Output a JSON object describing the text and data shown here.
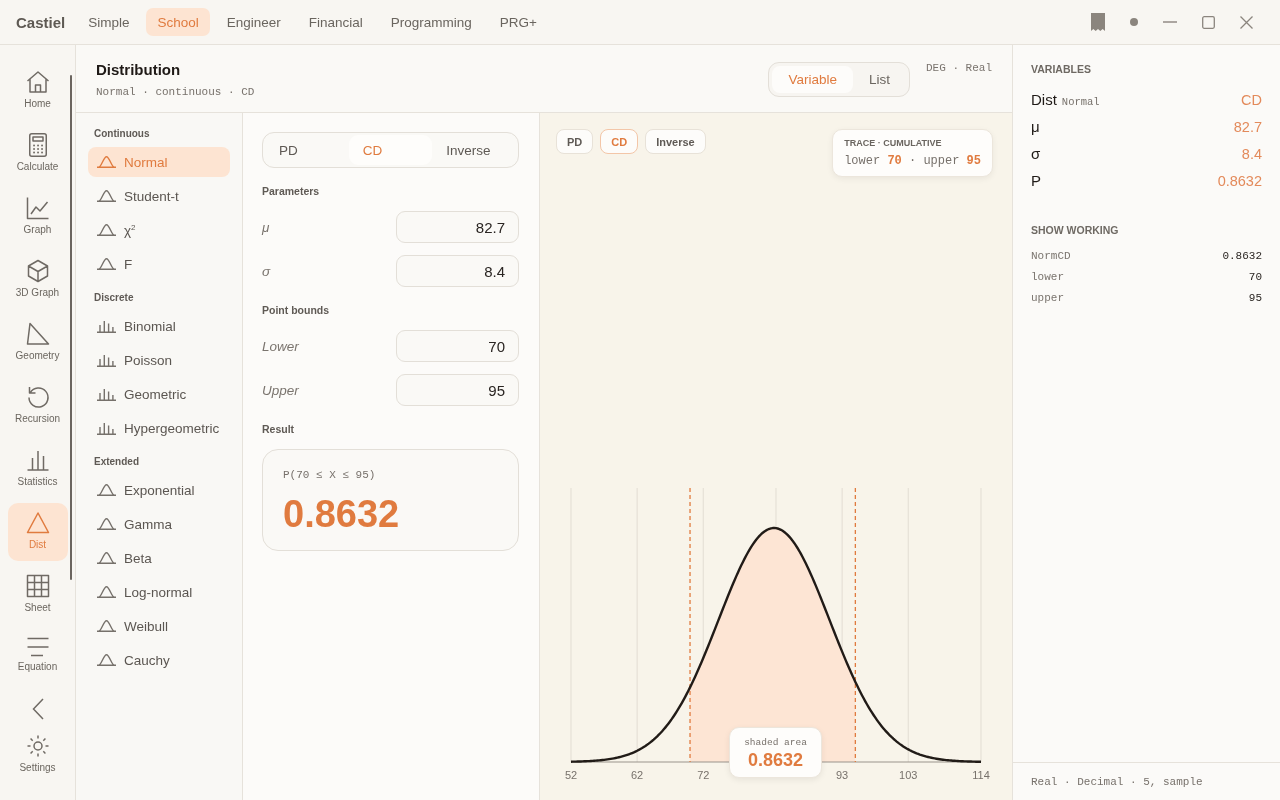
{
  "app": {
    "title": "Castiel"
  },
  "tabs": [
    {
      "label": "Simple",
      "selected": false
    },
    {
      "label": "School",
      "selected": true
    },
    {
      "label": "Engineer",
      "selected": false
    },
    {
      "label": "Financial",
      "selected": false
    },
    {
      "label": "Programming",
      "selected": false
    },
    {
      "label": "PRG+",
      "selected": false
    }
  ],
  "nav": {
    "items": [
      {
        "label": "Home",
        "kind": "home",
        "selected": false
      },
      {
        "label": "Calculate",
        "kind": "calculator",
        "selected": false
      },
      {
        "label": "Graph",
        "kind": "graph",
        "selected": false
      },
      {
        "label": "3D Graph",
        "kind": "cube",
        "selected": false
      },
      {
        "label": "Geometry",
        "kind": "geometry",
        "selected": false
      },
      {
        "label": "Recursion",
        "kind": "cycle",
        "selected": false
      },
      {
        "label": "Statistics",
        "kind": "bars",
        "selected": false
      },
      {
        "label": "Dist",
        "kind": "distribution",
        "selected": true
      },
      {
        "label": "Sheet",
        "kind": "grid",
        "selected": false
      },
      {
        "label": "Equation",
        "kind": "lines",
        "selected": false
      }
    ],
    "settings": {
      "label": "Settings"
    }
  },
  "header": {
    "title": "Distribution",
    "subtitle": "Normal · continuous · CD",
    "view_toggle": [
      {
        "label": "Variable",
        "selected": true
      },
      {
        "label": "List",
        "selected": false
      }
    ],
    "mode": "DEG · Real"
  },
  "distributions": [
    {
      "heading": "Continuous",
      "items": [
        {
          "label": "Normal",
          "kind": "curve",
          "selected": true
        },
        {
          "label": "Student-t",
          "kind": "curve",
          "selected": false
        },
        {
          "label": "χ$^{2}$",
          "kind": "curve",
          "selected": false
        },
        {
          "label": "F",
          "kind": "curve",
          "selected": false
        }
      ]
    },
    {
      "heading": "Discrete",
      "items": [
        {
          "label": "Binomial",
          "kind": "bars",
          "selected": false
        },
        {
          "label": "Poisson",
          "kind": "bars",
          "selected": false
        },
        {
          "label": "Geometric",
          "kind": "bars",
          "selected": false
        },
        {
          "label": "Hypergeometric",
          "kind": "bars",
          "selected": false
        }
      ]
    },
    {
      "heading": "Extended",
      "items": [
        {
          "label": "Exponential",
          "kind": "curve",
          "selected": false
        },
        {
          "label": "Gamma",
          "kind": "curve",
          "selected": false
        },
        {
          "label": "Beta",
          "kind": "curve",
          "selected": false
        },
        {
          "label": "Log-normal",
          "kind": "curve",
          "selected": false
        },
        {
          "label": "Weibull",
          "kind": "curve",
          "selected": false
        },
        {
          "label": "Cauchy",
          "kind": "curve",
          "selected": false
        }
      ]
    }
  ],
  "calculator": {
    "function_tabs": [
      {
        "label": "PD",
        "selected": false
      },
      {
        "label": "CD",
        "selected": true
      },
      {
        "label": "Inverse",
        "selected": false
      }
    ],
    "groups": [
      {
        "heading": "Parameters",
        "fields": [
          {
            "label": "μ",
            "value": "82.7"
          },
          {
            "label": "σ",
            "value": "8.4"
          }
        ]
      },
      {
        "heading": "Point bounds",
        "fields": [
          {
            "label": "Lower",
            "value": "70"
          },
          {
            "label": "Upper",
            "value": "95"
          }
        ]
      }
    ],
    "result": {
      "heading": "Result",
      "expression": "P(70 ≤ X ≤ 95)",
      "value": "0.8632"
    }
  },
  "chart": {
    "buttons": [
      {
        "label": "PD",
        "selected": false
      },
      {
        "label": "CD",
        "selected": true
      },
      {
        "label": "Inverse",
        "selected": false
      }
    ],
    "trace": {
      "title": "TRACE · CUMULATIVE",
      "text": "lower **70** · upper **95**"
    },
    "axis_labels": [
      "52",
      "62",
      "72",
      "93",
      "103",
      "114"
    ],
    "shaded_area": {
      "label": "shaded area",
      "value": "0.8632"
    }
  },
  "variables": {
    "heading": "VARIABLES",
    "rows": [
      {
        "name": "Dist",
        "note": "Normal",
        "value": "CD"
      },
      {
        "name": "μ",
        "value": "82.7"
      },
      {
        "name": "σ",
        "value": "8.4"
      },
      {
        "name": "P",
        "value": "0.8632"
      }
    ]
  },
  "working": {
    "heading": "SHOW WORKING",
    "rows": [
      {
        "name": "NormCD",
        "value": "0.8632"
      },
      {
        "name": "lower",
        "value": "70"
      },
      {
        "name": "upper",
        "value": "95"
      }
    ]
  },
  "status_bar": "Real · Decimal · 5, sample"
}
